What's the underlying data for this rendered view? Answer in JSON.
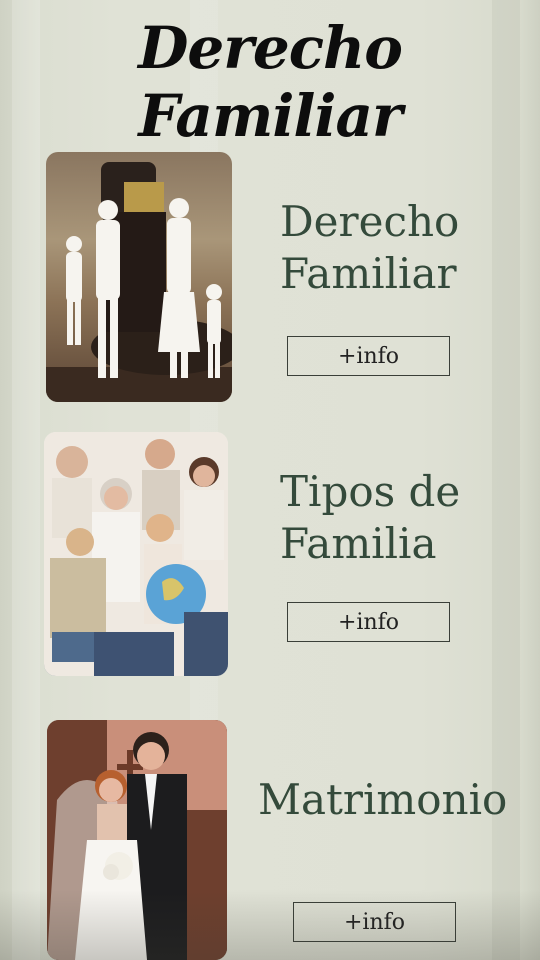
{
  "header": {
    "title": "Derecho Familiar"
  },
  "cards": [
    {
      "title": "Derecho Familiar",
      "button": "+info",
      "image_icon": "family-law-gavel-image"
    },
    {
      "title": "Tipos de Familia",
      "button": "+info",
      "image_icon": "family-group-image"
    },
    {
      "title": "Matrimonio",
      "button": "+info",
      "image_icon": "wedding-couple-image"
    }
  ]
}
